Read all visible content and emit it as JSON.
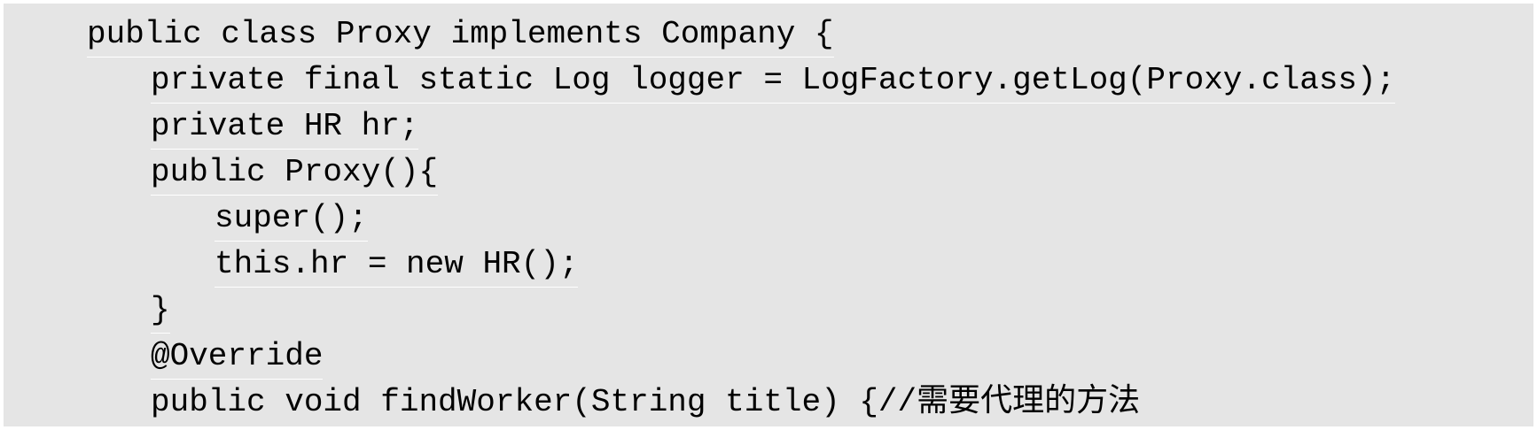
{
  "code": {
    "lines": [
      "public class Proxy implements Company {",
      "private final static Log logger = LogFactory.getLog(Proxy.class);",
      "private HR hr;",
      "public Proxy(){",
      "super();",
      "this.hr = new HR();",
      "}",
      "@Override",
      "public void findWorker(String title) {//需要代理的方法"
    ]
  }
}
